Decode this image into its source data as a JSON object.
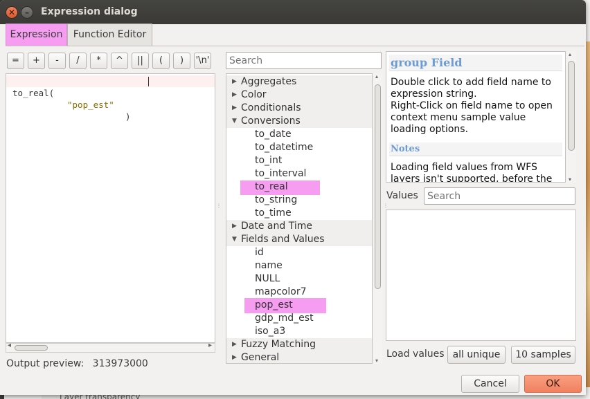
{
  "window": {
    "title": "Expression dialog"
  },
  "tabs": [
    {
      "label": "Expression",
      "active": true
    },
    {
      "label": "Function Editor",
      "active": false
    }
  ],
  "operators": [
    "=",
    "+",
    "-",
    "/",
    "*",
    "^",
    "||",
    "(",
    ")",
    "'\\n'"
  ],
  "editor": {
    "fn": "to_real(",
    "str": "\"pop_est\"",
    "paren": ")"
  },
  "output_preview": {
    "label": "Output preview:",
    "value": "313973000"
  },
  "function_search": {
    "placeholder": "Search"
  },
  "tree": [
    {
      "label": "Aggregates",
      "type": "group",
      "expanded": false
    },
    {
      "label": "Color",
      "type": "group",
      "expanded": false
    },
    {
      "label": "Conditionals",
      "type": "group",
      "expanded": false
    },
    {
      "label": "Conversions",
      "type": "group",
      "expanded": true
    },
    {
      "label": "to_date",
      "type": "child"
    },
    {
      "label": "to_datetime",
      "type": "child"
    },
    {
      "label": "to_int",
      "type": "child"
    },
    {
      "label": "to_interval",
      "type": "child"
    },
    {
      "label": "to_real",
      "type": "child",
      "highlight": true
    },
    {
      "label": "to_string",
      "type": "child"
    },
    {
      "label": "to_time",
      "type": "child"
    },
    {
      "label": "Date and Time",
      "type": "group",
      "expanded": false
    },
    {
      "label": "Fields and Values",
      "type": "group",
      "expanded": true
    },
    {
      "label": "id",
      "type": "child"
    },
    {
      "label": "name",
      "type": "child"
    },
    {
      "label": "NULL",
      "type": "child"
    },
    {
      "label": "mapcolor7",
      "type": "child"
    },
    {
      "label": "pop_est",
      "type": "child",
      "highlight": true,
      "selected": true
    },
    {
      "label": "gdp_md_est",
      "type": "child"
    },
    {
      "label": "iso_a3",
      "type": "child"
    },
    {
      "label": "Fuzzy Matching",
      "type": "group",
      "expanded": false
    },
    {
      "label": "General",
      "type": "group",
      "expanded": false
    }
  ],
  "help": {
    "title": "group Field",
    "line1": "Double click to add field name to expression string.",
    "line2": "Right-Click on field name to open context menu sample value loading options.",
    "notes_title": "Notes",
    "notes_text": "Loading field values from WFS layers isn't supported, before the"
  },
  "values": {
    "label": "Values",
    "placeholder": "Search",
    "load_label": "Load values",
    "all_unique": "all unique",
    "samples": "10 samples"
  },
  "buttons": {
    "cancel": "Cancel",
    "ok": "OK"
  },
  "background": {
    "status_text": "Layer transparency"
  },
  "colors": {
    "highlight": "#f69df2",
    "ok_button": "#f08060",
    "help_heading": "#6e9bd1",
    "string_literal": "#8a6b00"
  }
}
